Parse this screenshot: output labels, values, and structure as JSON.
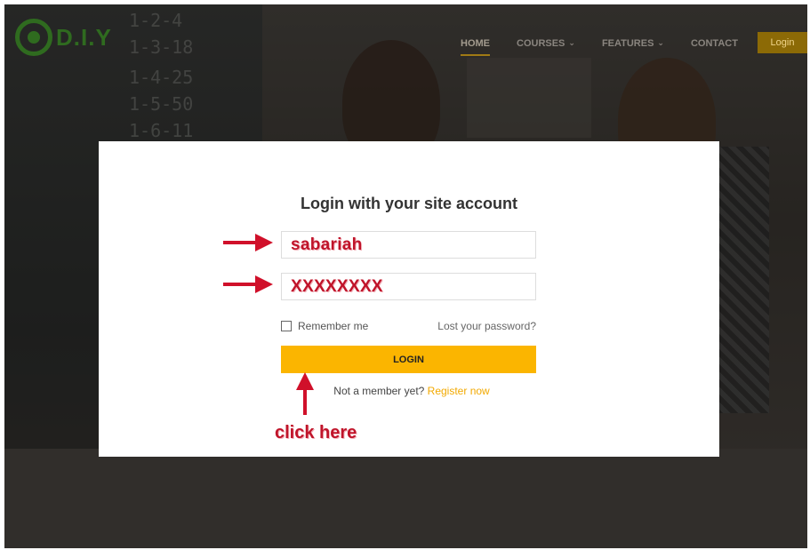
{
  "header": {
    "logo_text": "D.I.Y",
    "nav": [
      {
        "label": "HOME"
      },
      {
        "label": "COURSES",
        "has_dropdown": true
      },
      {
        "label": "FEATURES",
        "has_dropdown": true
      },
      {
        "label": "CONTACT"
      }
    ],
    "search_icon": "search-icon",
    "login_label": "Login"
  },
  "modal": {
    "title": "Login with your site account",
    "username_value": "sabariah",
    "password_value": "XXXXXXXX",
    "remember_label": "Remember me",
    "lost_password_label": "Lost your password?",
    "login_button_label": "LOGIN",
    "member_text": "Not a member yet?",
    "register_label": "Register now"
  },
  "annotation": {
    "click_here": "click here"
  },
  "background": {
    "chalkboard_lines": [
      "1-2-4",
      "1-3-18",
      "1-4-25",
      "1-5-50",
      "1-6-11"
    ]
  },
  "colors": {
    "accent": "#fbb500",
    "annotation_red": "#c0142a",
    "logo_green": "#2f6b1f"
  }
}
